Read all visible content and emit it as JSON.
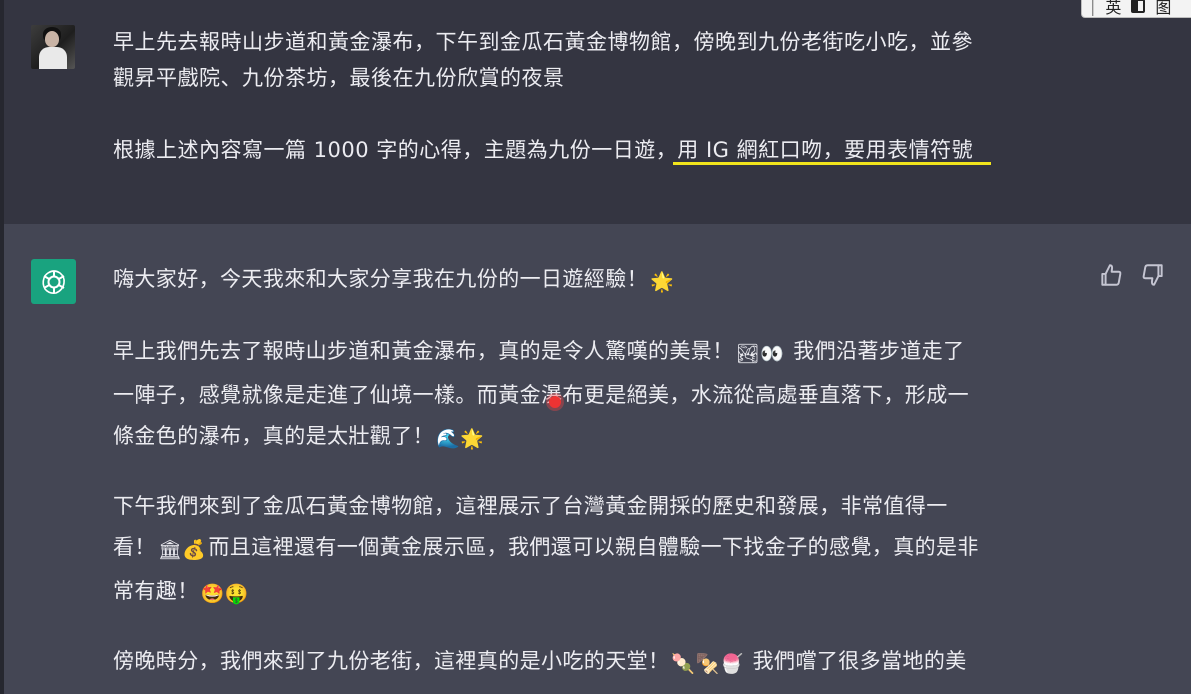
{
  "ime_bar": {
    "lang_label": "英",
    "extra": "图"
  },
  "user_message": {
    "line1": "早上先去報時山步道和黃金瀑布，下午到金瓜石黃金博物館，傍晚到九份老街吃小吃，並參",
    "line1b": "觀昇平戲院、九份茶坊，最後在九份欣賞的夜景",
    "line2_plain": "根據上述內容寫一篇 1000 字的心得，主題為九份一日遊，",
    "line2_highlight": "用 IG 網紅口吻，要用表情符號"
  },
  "assistant_message": {
    "p0": {
      "text": "嗨大家好，今天我來和大家分享我在九份的一日遊經驗！",
      "emoji": "🌟"
    },
    "p1": {
      "l1a": "早上我們先去了報時山步道和黃金瀑布，真的是令人驚嘆的美景！",
      "l1_emoji": "🏞👀",
      "l1b": "我們沿著步道走了",
      "l2": "一陣子，感覺就像是走進了仙境一樣。而黃金瀑布更是絕美，水流從高處垂直落下，形成一",
      "l3": "條金色的瀑布，真的是太壯觀了！",
      "l3_emoji": "🌊🌟"
    },
    "p2": {
      "l1": "下午我們來到了金瓜石黃金博物館，這裡展示了台灣黃金開採的歷史和發展，非常值得一",
      "l2_start": "看！",
      "l2_emoji": "🏛💰",
      "l2_rest": "而且這裡還有一個黃金展示區，我們還可以親自體驗一下找金子的感覺，真的是非",
      "l3": "常有趣！",
      "l3_emoji": "🤩🤑"
    },
    "p3": {
      "l1": "傍晚時分，我們來到了九份老街，這裡真的是小吃的天堂！",
      "l1_emoji": "🍡🍢🍧",
      "l1b": "我們嚐了很多當地的美"
    }
  },
  "colors": {
    "user_bg": "#343541",
    "assistant_bg": "#444654",
    "text": "#ececf1",
    "highlight_underline": "#f2e51c",
    "gpt_avatar_bg": "#19a37f"
  },
  "icons": [
    "user-avatar",
    "openai-logo-icon",
    "thumbs-up-icon",
    "thumbs-down-icon"
  ]
}
